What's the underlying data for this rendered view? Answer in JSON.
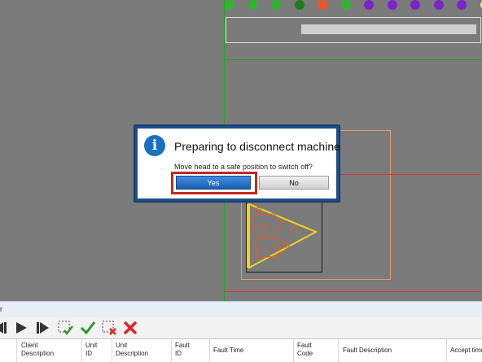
{
  "dialog": {
    "title": "Preparing to disconnect machine",
    "message": "Move head to a safe position to switch off?",
    "yes_label": "Yes",
    "no_label": "No",
    "icon": "info-icon"
  },
  "status_dots": [
    {
      "color": "#2fb52f"
    },
    {
      "color": "#2fb52f"
    },
    {
      "color": "#2fb52f"
    },
    {
      "color": "#1f7a1f"
    },
    {
      "color": "#f0542a"
    },
    {
      "color": "#2fb52f"
    },
    {
      "color": "#7a25c8"
    },
    {
      "color": "#7a25c8"
    },
    {
      "color": "#7a25c8"
    },
    {
      "color": "#7a25c8"
    },
    {
      "color": "#7a25c8"
    },
    {
      "color": "#f6f047"
    }
  ],
  "panel": {
    "title": "r"
  },
  "toolbar": [
    "skip-back-icon",
    "play-icon",
    "skip-forward-icon",
    "select-check-icon",
    "check-icon",
    "select-delete-icon",
    "delete-icon"
  ],
  "table": {
    "columns": [
      {
        "label": "Client\nDescription"
      },
      {
        "label": "Unit\nID"
      },
      {
        "label": "Unit\nDescription"
      },
      {
        "label": "Fault\nID"
      },
      {
        "label": "Fault Time"
      },
      {
        "label": "Fault\nCode"
      },
      {
        "label": "Fault Description"
      },
      {
        "label": "Accept time"
      }
    ]
  },
  "colors": {
    "accent": "#1f4f8a",
    "highlight": "#c12a20",
    "canvas": "#7b7b7b"
  }
}
